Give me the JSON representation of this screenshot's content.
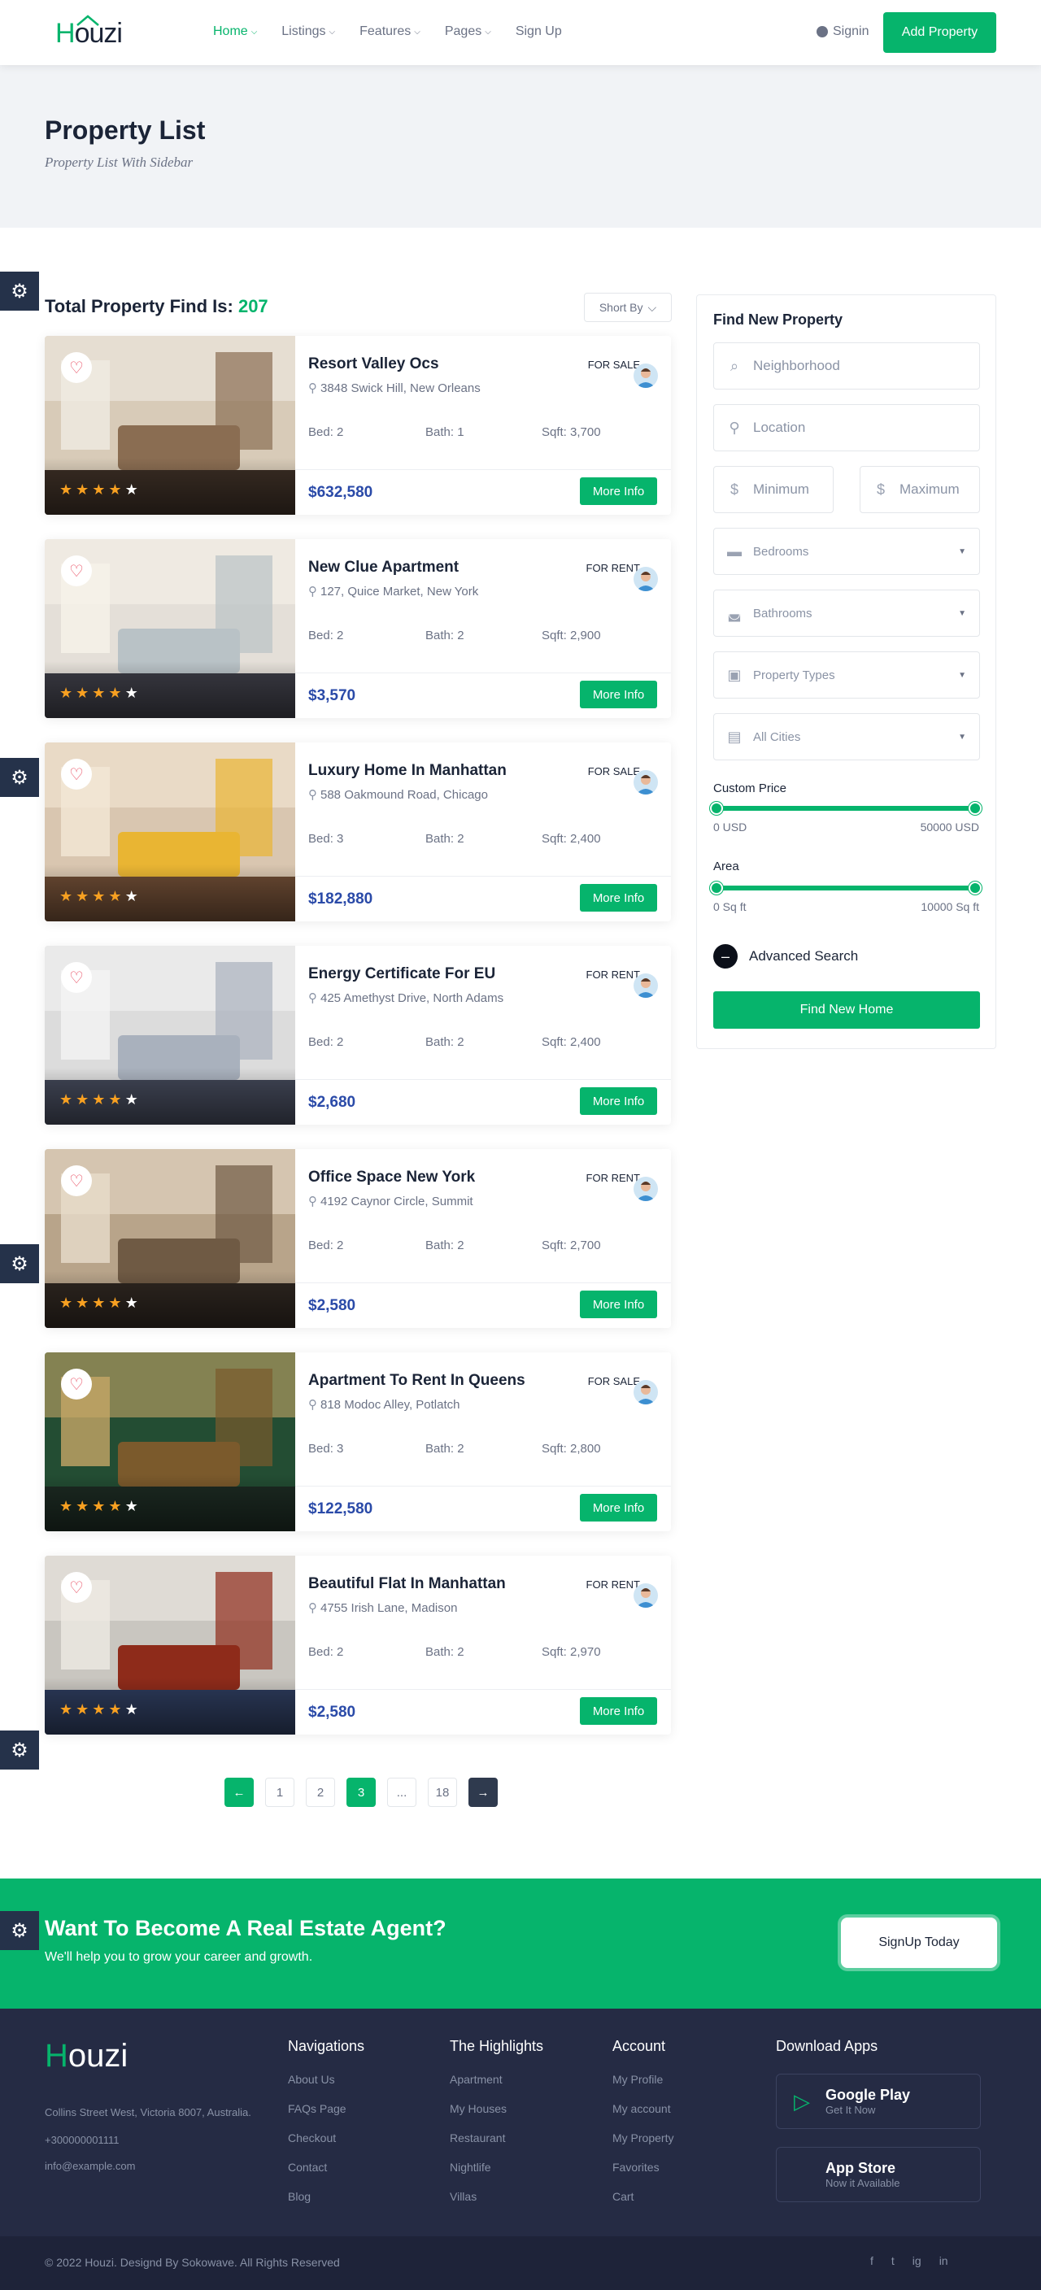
{
  "header": {
    "logo_h": "H",
    "logo_rest": "ouzi",
    "nav": [
      {
        "label": "Home",
        "active": true,
        "dropdown": true
      },
      {
        "label": "Listings",
        "active": false,
        "dropdown": true
      },
      {
        "label": "Features",
        "active": false,
        "dropdown": true
      },
      {
        "label": "Pages",
        "active": false,
        "dropdown": true
      },
      {
        "label": "Sign Up",
        "active": false,
        "dropdown": false
      }
    ],
    "signin": "Signin",
    "add_property": "Add Property"
  },
  "banner": {
    "title": "Property List",
    "subtitle": "Property List With Sidebar"
  },
  "results": {
    "total_label": "Total Property Find Is:",
    "total_count": "207",
    "sort_label": "Short By"
  },
  "labels": {
    "bed": "Bed:",
    "bath": "Bath:",
    "sqft": "Sqft:",
    "more_info": "More Info"
  },
  "listings": [
    {
      "title": "Resort Valley Ocs",
      "address": "3848 Swick Hill, New Orleans",
      "status": "FOR SALE",
      "bed": "2",
      "bath": "1",
      "sqft": "3,700",
      "price": "$632,580",
      "rating": 4
    },
    {
      "title": "New Clue Apartment",
      "address": "127, Quice Market, New York",
      "status": "FOR RENT",
      "bed": "2",
      "bath": "2",
      "sqft": "2,900",
      "price": "$3,570",
      "rating": 4
    },
    {
      "title": "Luxury Home In Manhattan",
      "address": "588 Oakmound Road, Chicago",
      "status": "FOR SALE",
      "bed": "3",
      "bath": "2",
      "sqft": "2,400",
      "price": "$182,880",
      "rating": 4
    },
    {
      "title": "Energy Certificate For EU",
      "address": "425 Amethyst Drive, North Adams",
      "status": "FOR RENT",
      "bed": "2",
      "bath": "2",
      "sqft": "2,400",
      "price": "$2,680",
      "rating": 4
    },
    {
      "title": "Office Space New York",
      "address": "4192 Caynor Circle, Summit",
      "status": "FOR RENT",
      "bed": "2",
      "bath": "2",
      "sqft": "2,700",
      "price": "$2,580",
      "rating": 4
    },
    {
      "title": "Apartment To Rent In Queens",
      "address": "818 Modoc Alley, Potlatch",
      "status": "FOR SALE",
      "bed": "3",
      "bath": "2",
      "sqft": "2,800",
      "price": "$122,580",
      "rating": 4
    },
    {
      "title": "Beautiful Flat In Manhattan",
      "address": "4755 Irish Lane, Madison",
      "status": "FOR RENT",
      "bed": "2",
      "bath": "2",
      "sqft": "2,970",
      "price": "$2,580",
      "rating": 4
    }
  ],
  "pagination": [
    "1",
    "2",
    "3",
    "...",
    "18"
  ],
  "pagination_active": "3",
  "sidebar": {
    "title": "Find New Property",
    "neighborhood_placeholder": "Neighborhood",
    "location_placeholder": "Location",
    "min_placeholder": "Minimum",
    "max_placeholder": "Maximum",
    "bedrooms": "Bedrooms",
    "bathrooms": "Bathrooms",
    "property_types": "Property Types",
    "all_cities": "All Cities",
    "price_label": "Custom Price",
    "price_min": "0 USD",
    "price_max": "50000 USD",
    "area_label": "Area",
    "area_min": "0 Sq ft",
    "area_max": "10000 Sq ft",
    "advanced": "Advanced Search",
    "find_button": "Find New Home"
  },
  "cta": {
    "title": "Want To Become A Real Estate Agent?",
    "subtitle": "We'll help you to grow your career and growth.",
    "button": "SignUp Today"
  },
  "footer": {
    "address": "Collins Street West, Victoria 8007, Australia.",
    "phone": "+300000001111",
    "email": "info@example.com",
    "columns": [
      {
        "title": "Navigations",
        "links": [
          "About Us",
          "FAQs Page",
          "Checkout",
          "Contact",
          "Blog"
        ]
      },
      {
        "title": "The Highlights",
        "links": [
          "Apartment",
          "My Houses",
          "Restaurant",
          "Nightlife",
          "Villas"
        ]
      },
      {
        "title": "Account",
        "links": [
          "My Profile",
          "My account",
          "My Property",
          "Favorites",
          "Cart"
        ]
      }
    ],
    "apps_title": "Download Apps",
    "google_title": "Google Play",
    "google_sub": "Get It Now",
    "apple_title": "App Store",
    "apple_sub": "Now it Available",
    "copyright": "© 2022 Houzi. Designd By Sokowave. All Rights Reserved",
    "social": [
      "f",
      "t",
      "ig",
      "in"
    ]
  },
  "colors": {
    "accent": "#06b46c",
    "dark": "#252b44",
    "price": "#2a4aa8"
  }
}
